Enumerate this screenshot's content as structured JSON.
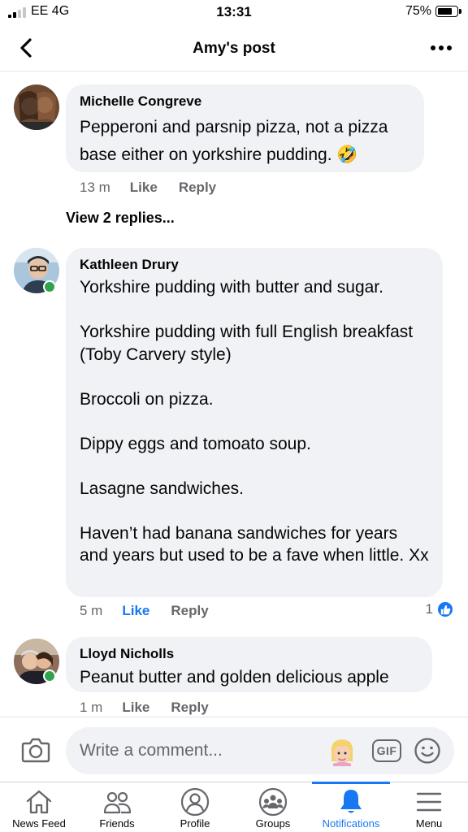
{
  "status_bar": {
    "carrier": "EE  4G",
    "time": "13:31",
    "battery": "75%"
  },
  "header": {
    "title": "Amy's post",
    "back_icon": "chevron-left-icon",
    "more_icon": "more-dots-icon"
  },
  "comments": [
    {
      "author": "Michelle Congreve",
      "text": "Pepperoni and parsnip pizza, not a pizza base either on yorkshire pudding. 🤣",
      "time": "13 m",
      "like_label": "Like",
      "reply_label": "Reply",
      "like_active": false
    },
    {
      "author": "Kathleen Drury",
      "online": true,
      "text": "Yorkshire pudding with butter and sugar.\n\nYorkshire pudding with full English breakfast (Toby Carvery style)\n\nBroccoli on pizza.\n\nDippy eggs and tomoato soup.\n\nLasagne sandwiches.\n\nHaven’t had banana sandwiches for years and years but used to be a fave when little. Xx",
      "time": "5 m",
      "like_label": "Like",
      "reply_label": "Reply",
      "like_active": true,
      "reaction_count": "1"
    },
    {
      "author": "Lloyd Nicholls",
      "online": true,
      "text": "Peanut butter and golden delicious  apple",
      "time": "1 m",
      "like_label": "Like",
      "reply_label": "Reply",
      "like_active": false
    }
  ],
  "view_replies": "View 2 replies...",
  "composer": {
    "placeholder": "Write a comment...",
    "gif_label": "GIF"
  },
  "tabs": [
    {
      "label": "News Feed",
      "icon": "home-icon"
    },
    {
      "label": "Friends",
      "icon": "friends-icon"
    },
    {
      "label": "Profile",
      "icon": "profile-icon"
    },
    {
      "label": "Groups",
      "icon": "groups-icon"
    },
    {
      "label": "Notifications",
      "icon": "bell-icon",
      "active": true
    },
    {
      "label": "Menu",
      "icon": "menu-icon"
    }
  ],
  "colors": {
    "accent": "#1877f2",
    "bubble": "#f0f2f5",
    "secondary_text": "#65676b",
    "online": "#31a24c"
  }
}
